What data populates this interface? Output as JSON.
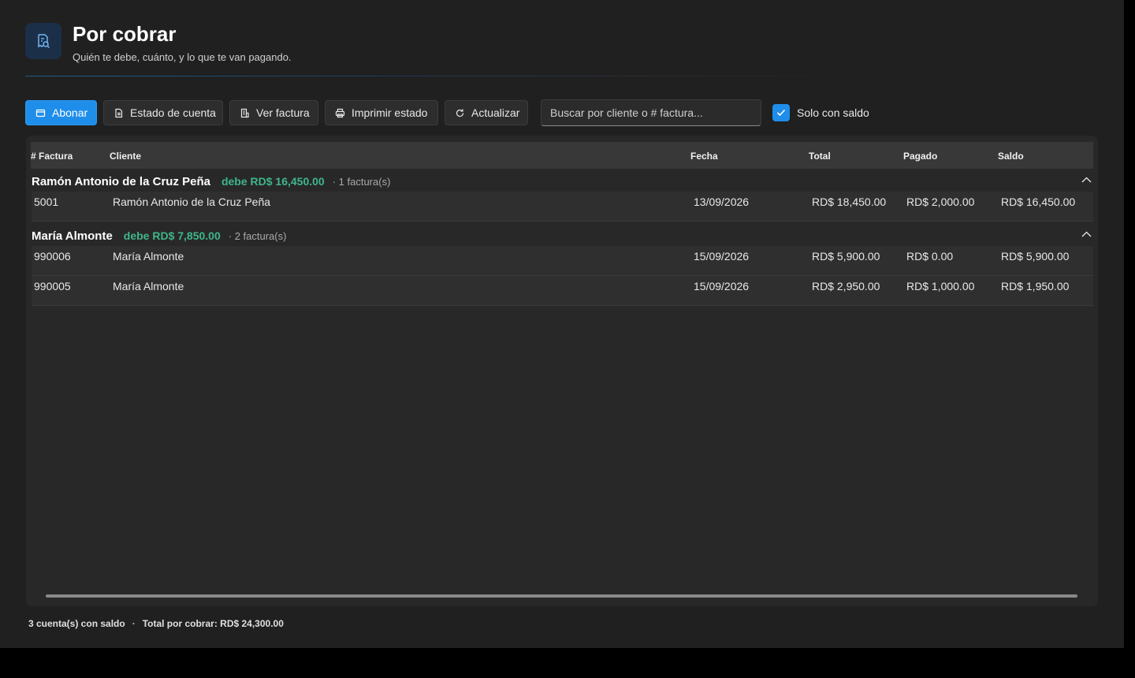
{
  "header": {
    "title": "Por cobrar",
    "subtitle": "Quién te debe, cuánto, y lo que te van pagando.",
    "icon": "receipt-search-icon"
  },
  "toolbar": {
    "abonar": "Abonar",
    "estado_cuenta": "Estado de cuenta",
    "ver_factura": "Ver factura",
    "imprimir_estado": "Imprimir estado",
    "actualizar": "Actualizar",
    "search_placeholder": "Buscar por cliente o # factura...",
    "solo_con_saldo": "Solo con saldo",
    "solo_con_saldo_checked": true
  },
  "grid": {
    "columns": {
      "factura": "# Factura",
      "cliente": "Cliente",
      "fecha": "Fecha",
      "total": "Total",
      "pagado": "Pagado",
      "saldo": "Saldo"
    },
    "groups": [
      {
        "name": "Ramón Antonio de la Cruz Peña",
        "owed": "debe RD$ 16,450.00",
        "count": "· 1 factura(s)",
        "rows": [
          {
            "factura": "5001",
            "cliente": "Ramón Antonio de la Cruz Peña",
            "fecha": "13/09/2026",
            "total": "RD$ 18,450.00",
            "pagado": "RD$ 2,000.00",
            "saldo": "RD$ 16,450.00"
          }
        ]
      },
      {
        "name": "María Almonte",
        "owed": "debe RD$ 7,850.00",
        "count": "· 2 factura(s)",
        "rows": [
          {
            "factura": "990006",
            "cliente": "María Almonte",
            "fecha": "15/09/2026",
            "total": "RD$ 5,900.00",
            "pagado": "RD$ 0.00",
            "saldo": "RD$ 5,900.00"
          },
          {
            "factura": "990005",
            "cliente": "María Almonte",
            "fecha": "15/09/2026",
            "total": "RD$ 2,950.00",
            "pagado": "RD$ 1,000.00",
            "saldo": "RD$ 1,950.00"
          }
        ]
      }
    ]
  },
  "footer": {
    "cuentas": "3 cuenta(s) con saldo",
    "total": "Total por cobrar: RD$ 24,300.00"
  },
  "colors": {
    "accent": "#1f8eea",
    "owed": "#3fb68b",
    "background": "#202020"
  }
}
